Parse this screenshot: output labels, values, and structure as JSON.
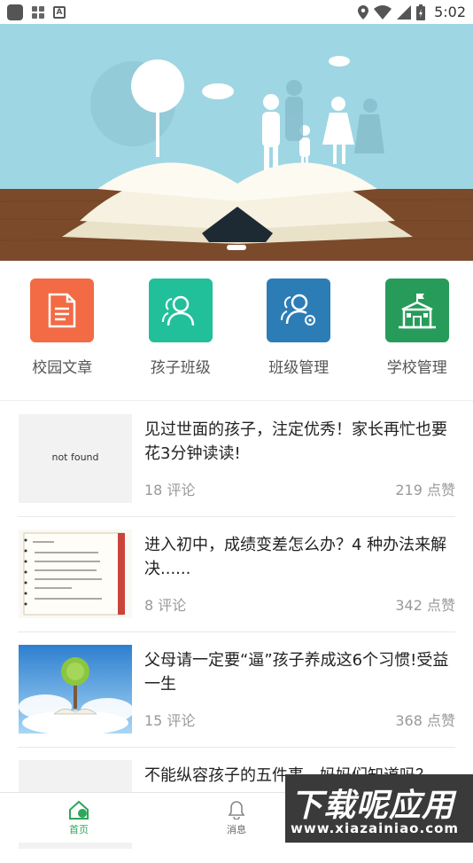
{
  "status_bar": {
    "time": "5:02"
  },
  "quick_nav": [
    {
      "label": "校园文章",
      "color": "#f26b45",
      "icon": "document-icon"
    },
    {
      "label": "孩子班级",
      "color": "#22bf9b",
      "icon": "users-icon"
    },
    {
      "label": "班级管理",
      "color": "#2c7db6",
      "icon": "users-settings-icon"
    },
    {
      "label": "学校管理",
      "color": "#279c5a",
      "icon": "school-icon"
    }
  ],
  "articles": [
    {
      "title": "见过世面的孩子，注定优秀！家长再忙也要花3分钟读读!",
      "comments": "18 评论",
      "likes": "219 点赞",
      "thumb_text": "not found"
    },
    {
      "title": "进入初中，成绩变差怎么办？4 种办法来解决......",
      "comments": "8 评论",
      "likes": "342 点赞"
    },
    {
      "title": "父母请一定要“逼”孩子养成这6个习惯!受益一生",
      "comments": "15 评论",
      "likes": "368 点赞"
    },
    {
      "title": "不能纵容孩子的五件事，妈妈们知道吗？",
      "comments": "",
      "likes": ""
    }
  ],
  "bottom_nav": [
    {
      "label": "首页",
      "active": true
    },
    {
      "label": "消息",
      "active": false
    }
  ],
  "watermark": {
    "main": "下载呢应用",
    "url": "www.xiazainiao.com"
  },
  "colors": {
    "accent": "#2fa65a",
    "sky": "#9fd6e3",
    "table": "#7a4a2b"
  }
}
